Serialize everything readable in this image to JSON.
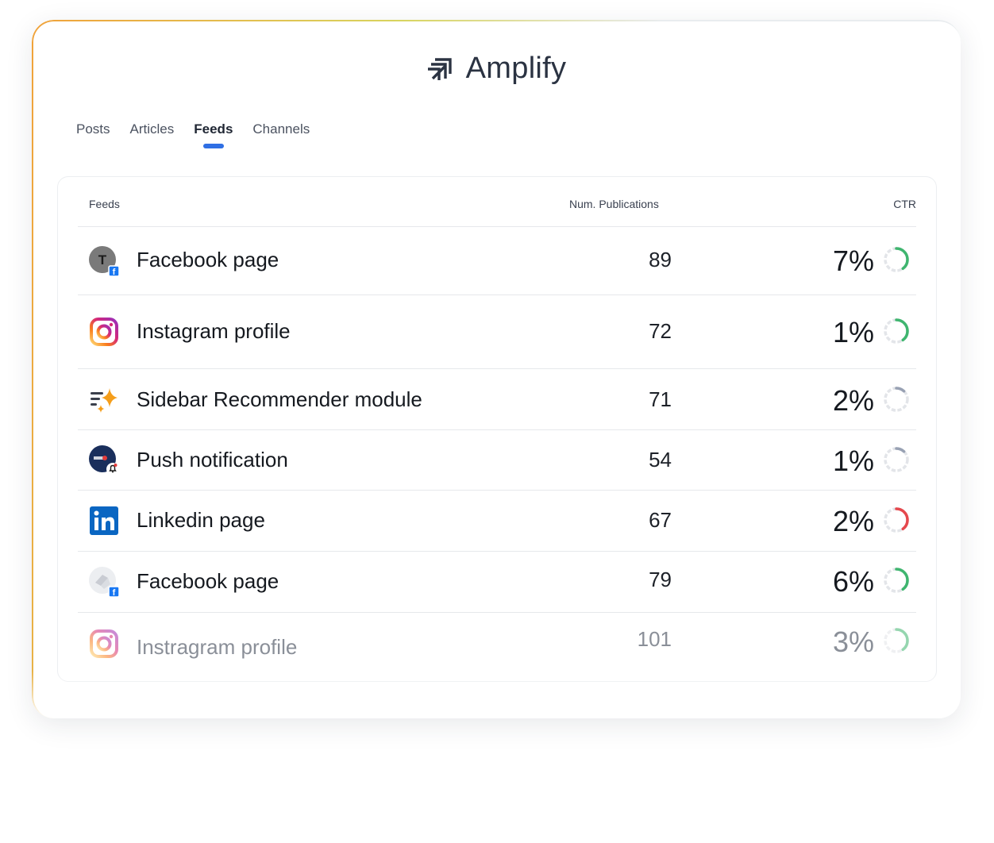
{
  "app": {
    "name": "Amplify"
  },
  "tabs": [
    {
      "label": "Posts",
      "active": false
    },
    {
      "label": "Articles",
      "active": false
    },
    {
      "label": "Feeds",
      "active": true
    },
    {
      "label": "Channels",
      "active": false
    }
  ],
  "table": {
    "headers": {
      "feeds": "Feeds",
      "publications": "Num. Publications",
      "ctr": "CTR"
    },
    "rows": [
      {
        "icon": "facebook-page-avatar-icon",
        "name": "Facebook page",
        "publications": "89",
        "ctr": "7%",
        "ring_color": "#3fb56f",
        "ring_fraction": 0.4
      },
      {
        "icon": "instagram-icon",
        "name": "Instagram profile",
        "publications": "72",
        "ctr": "1%",
        "ring_color": "#3fb56f",
        "ring_fraction": 0.4
      },
      {
        "icon": "sparkle-list-icon",
        "name": "Sidebar Recommender module",
        "publications": "71",
        "ctr": "2%",
        "ring_color": "#98a1b3",
        "ring_fraction": 0.12
      },
      {
        "icon": "push-notification-avatar-icon",
        "name": "Push notification",
        "publications": "54",
        "ctr": "1%",
        "ring_color": "#98a1b3",
        "ring_fraction": 0.12
      },
      {
        "icon": "linkedin-icon",
        "name": "Linkedin page",
        "publications": "67",
        "ctr": "2%",
        "ring_color": "#e5484d",
        "ring_fraction": 0.4
      },
      {
        "icon": "facebook-page-avatar-icon",
        "name": "Facebook page",
        "publications": "79",
        "ctr": "6%",
        "ring_color": "#3fb56f",
        "ring_fraction": 0.4
      },
      {
        "icon": "instagram-icon",
        "name": "Instragram profile",
        "publications": "101",
        "ctr": "3%",
        "ring_color": "#3fb56f",
        "ring_fraction": 0.4
      }
    ]
  }
}
